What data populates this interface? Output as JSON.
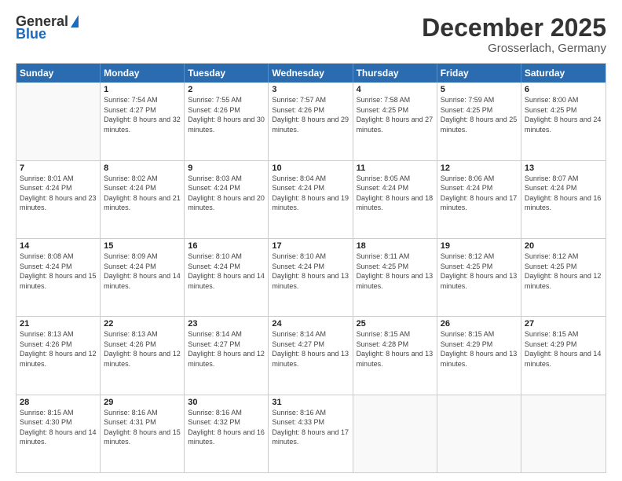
{
  "header": {
    "logo_general": "General",
    "logo_blue": "Blue",
    "title": "December 2025",
    "location": "Grosserlach, Germany"
  },
  "days_of_week": [
    "Sunday",
    "Monday",
    "Tuesday",
    "Wednesday",
    "Thursday",
    "Friday",
    "Saturday"
  ],
  "weeks": [
    [
      {
        "day": "",
        "sunrise": "",
        "sunset": "",
        "daylight": ""
      },
      {
        "day": "1",
        "sunrise": "7:54 AM",
        "sunset": "4:27 PM",
        "daylight": "8 hours and 32 minutes."
      },
      {
        "day": "2",
        "sunrise": "7:55 AM",
        "sunset": "4:26 PM",
        "daylight": "8 hours and 30 minutes."
      },
      {
        "day": "3",
        "sunrise": "7:57 AM",
        "sunset": "4:26 PM",
        "daylight": "8 hours and 29 minutes."
      },
      {
        "day": "4",
        "sunrise": "7:58 AM",
        "sunset": "4:25 PM",
        "daylight": "8 hours and 27 minutes."
      },
      {
        "day": "5",
        "sunrise": "7:59 AM",
        "sunset": "4:25 PM",
        "daylight": "8 hours and 25 minutes."
      },
      {
        "day": "6",
        "sunrise": "8:00 AM",
        "sunset": "4:25 PM",
        "daylight": "8 hours and 24 minutes."
      }
    ],
    [
      {
        "day": "7",
        "sunrise": "8:01 AM",
        "sunset": "4:24 PM",
        "daylight": "8 hours and 23 minutes."
      },
      {
        "day": "8",
        "sunrise": "8:02 AM",
        "sunset": "4:24 PM",
        "daylight": "8 hours and 21 minutes."
      },
      {
        "day": "9",
        "sunrise": "8:03 AM",
        "sunset": "4:24 PM",
        "daylight": "8 hours and 20 minutes."
      },
      {
        "day": "10",
        "sunrise": "8:04 AM",
        "sunset": "4:24 PM",
        "daylight": "8 hours and 19 minutes."
      },
      {
        "day": "11",
        "sunrise": "8:05 AM",
        "sunset": "4:24 PM",
        "daylight": "8 hours and 18 minutes."
      },
      {
        "day": "12",
        "sunrise": "8:06 AM",
        "sunset": "4:24 PM",
        "daylight": "8 hours and 17 minutes."
      },
      {
        "day": "13",
        "sunrise": "8:07 AM",
        "sunset": "4:24 PM",
        "daylight": "8 hours and 16 minutes."
      }
    ],
    [
      {
        "day": "14",
        "sunrise": "8:08 AM",
        "sunset": "4:24 PM",
        "daylight": "8 hours and 15 minutes."
      },
      {
        "day": "15",
        "sunrise": "8:09 AM",
        "sunset": "4:24 PM",
        "daylight": "8 hours and 14 minutes."
      },
      {
        "day": "16",
        "sunrise": "8:10 AM",
        "sunset": "4:24 PM",
        "daylight": "8 hours and 14 minutes."
      },
      {
        "day": "17",
        "sunrise": "8:10 AM",
        "sunset": "4:24 PM",
        "daylight": "8 hours and 13 minutes."
      },
      {
        "day": "18",
        "sunrise": "8:11 AM",
        "sunset": "4:25 PM",
        "daylight": "8 hours and 13 minutes."
      },
      {
        "day": "19",
        "sunrise": "8:12 AM",
        "sunset": "4:25 PM",
        "daylight": "8 hours and 13 minutes."
      },
      {
        "day": "20",
        "sunrise": "8:12 AM",
        "sunset": "4:25 PM",
        "daylight": "8 hours and 12 minutes."
      }
    ],
    [
      {
        "day": "21",
        "sunrise": "8:13 AM",
        "sunset": "4:26 PM",
        "daylight": "8 hours and 12 minutes."
      },
      {
        "day": "22",
        "sunrise": "8:13 AM",
        "sunset": "4:26 PM",
        "daylight": "8 hours and 12 minutes."
      },
      {
        "day": "23",
        "sunrise": "8:14 AM",
        "sunset": "4:27 PM",
        "daylight": "8 hours and 12 minutes."
      },
      {
        "day": "24",
        "sunrise": "8:14 AM",
        "sunset": "4:27 PM",
        "daylight": "8 hours and 13 minutes."
      },
      {
        "day": "25",
        "sunrise": "8:15 AM",
        "sunset": "4:28 PM",
        "daylight": "8 hours and 13 minutes."
      },
      {
        "day": "26",
        "sunrise": "8:15 AM",
        "sunset": "4:29 PM",
        "daylight": "8 hours and 13 minutes."
      },
      {
        "day": "27",
        "sunrise": "8:15 AM",
        "sunset": "4:29 PM",
        "daylight": "8 hours and 14 minutes."
      }
    ],
    [
      {
        "day": "28",
        "sunrise": "8:15 AM",
        "sunset": "4:30 PM",
        "daylight": "8 hours and 14 minutes."
      },
      {
        "day": "29",
        "sunrise": "8:16 AM",
        "sunset": "4:31 PM",
        "daylight": "8 hours and 15 minutes."
      },
      {
        "day": "30",
        "sunrise": "8:16 AM",
        "sunset": "4:32 PM",
        "daylight": "8 hours and 16 minutes."
      },
      {
        "day": "31",
        "sunrise": "8:16 AM",
        "sunset": "4:33 PM",
        "daylight": "8 hours and 17 minutes."
      },
      {
        "day": "",
        "sunrise": "",
        "sunset": "",
        "daylight": ""
      },
      {
        "day": "",
        "sunrise": "",
        "sunset": "",
        "daylight": ""
      },
      {
        "day": "",
        "sunrise": "",
        "sunset": "",
        "daylight": ""
      }
    ]
  ]
}
